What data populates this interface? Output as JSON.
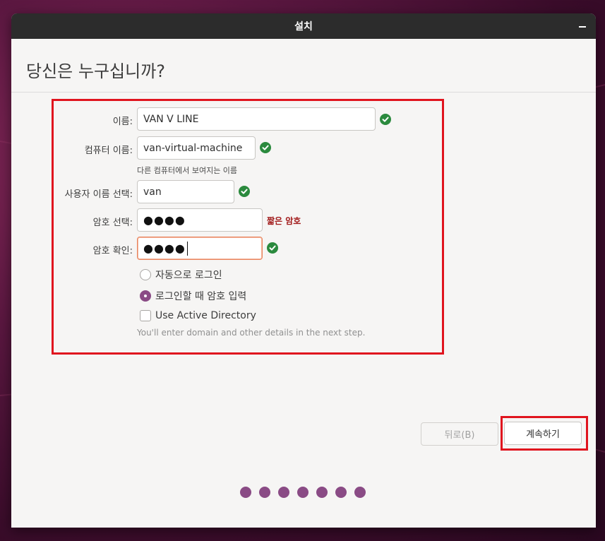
{
  "window": {
    "title": "설치"
  },
  "page": {
    "title": "당신은 누구십니까?"
  },
  "form": {
    "name": {
      "label": "이름:",
      "value": "VAN V LINE"
    },
    "computer_name": {
      "label": "컴퓨터 이름:",
      "value": "van-virtual-machine",
      "hint": "다른 컴퓨터에서 보여지는 이름"
    },
    "username": {
      "label": "사용자 이름 선택:",
      "value": "van"
    },
    "password": {
      "label": "암호 선택:",
      "value": "●●●●",
      "strength": "짧은 암호"
    },
    "confirm_password": {
      "label": "암호 확인:",
      "value": "●●●●"
    },
    "options": {
      "auto_login": {
        "label": "자동으로 로그인",
        "checked": false
      },
      "require_password": {
        "label": "로그인할 때 암호 입력",
        "checked": true
      },
      "active_directory": {
        "label": "Use Active Directory",
        "checked": false,
        "note": "You'll enter domain and other details in the next step."
      }
    }
  },
  "buttons": {
    "back": "뒤로(B)",
    "next": "계속하기"
  },
  "progress": {
    "total_steps": 7
  },
  "colors": {
    "accent": "#8a4b85",
    "check": "#2b8a3e",
    "highlight": "#e0141e",
    "warning": "#a11a1a",
    "titlebar": "#2c2c2c"
  },
  "icons": {
    "valid": "check-circle-icon",
    "minimize": "minimize-icon"
  }
}
